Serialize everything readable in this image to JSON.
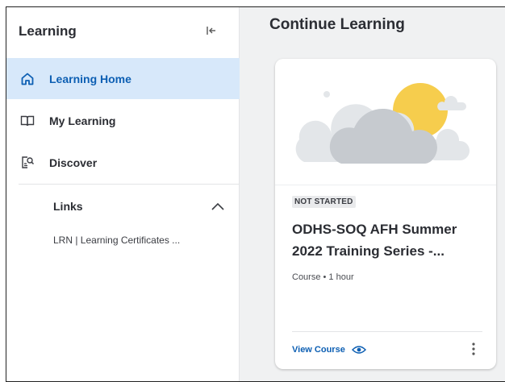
{
  "sidebar": {
    "title": "Learning",
    "collapse_icon": "collapse-left-icon",
    "items": [
      {
        "label": "Learning Home",
        "icon": "home-icon",
        "active": true
      },
      {
        "label": "My Learning",
        "icon": "book-icon",
        "active": false
      },
      {
        "label": "Discover",
        "icon": "discover-icon",
        "active": false
      }
    ],
    "links": {
      "label": "Links",
      "expanded": true,
      "items": [
        {
          "label": "LRN | Learning Certificates ..."
        }
      ]
    }
  },
  "main": {
    "title": "Continue Learning",
    "card": {
      "status": "NOT STARTED",
      "title": "ODHS-SOQ AFH Summer 2022 Training Series -...",
      "meta": "Course • 1 hour",
      "action_label": "View Course",
      "action_icon": "eye-icon",
      "menu_icon": "more-vert-icon",
      "image": "cloud-sun-illustration"
    }
  },
  "colors": {
    "accent": "#0d5fb3",
    "active_bg": "#d7e8fa",
    "page_bg": "#f0f1f2",
    "sun": "#f6cd4d",
    "cloud": "#c6cacf"
  }
}
